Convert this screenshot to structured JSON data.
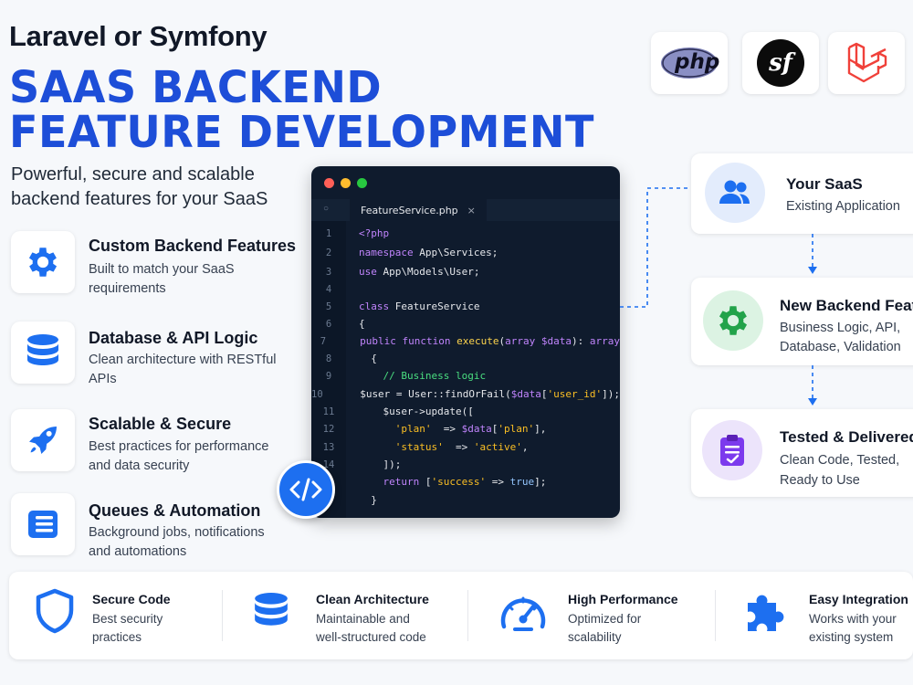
{
  "header": {
    "eyebrow": "Laravel or Symfony",
    "title_line1": "SAAS BACKEND",
    "title_line2": "FEATURE DEVELOPMENT",
    "subtitle": "Powerful, secure and scalable backend features for your SaaS"
  },
  "logos": [
    {
      "name": "php-logo",
      "text": "php"
    },
    {
      "name": "symfony-logo",
      "text": "sf"
    },
    {
      "name": "laravel-logo",
      "text": ""
    }
  ],
  "features": [
    {
      "title": "Custom Backend Features",
      "desc": "Built to match your SaaS requirements",
      "icon": "gear-icon"
    },
    {
      "title": "Database & API Logic",
      "desc": "Clean architecture with RESTful APIs",
      "icon": "database-icon"
    },
    {
      "title": "Scalable & Secure",
      "desc": "Best practices for performance and data security",
      "icon": "rocket-icon"
    },
    {
      "title": "Queues & Automation",
      "desc": "Background jobs, notifications and automations",
      "icon": "list-icon"
    }
  ],
  "editor": {
    "tab_label": "FeatureService.php",
    "line_numbers": [
      "1",
      "2",
      "3",
      "4",
      "5",
      "6",
      "7",
      "8",
      "9",
      "10",
      "11",
      "12",
      "13",
      "14"
    ]
  },
  "flow": [
    {
      "title": "Your SaaS",
      "desc1": "Existing Application",
      "desc2": "",
      "icon": "users-icon"
    },
    {
      "title": "New Backend Feat",
      "desc1": "Business Logic, API,",
      "desc2": "Database, Validation",
      "icon": "gear-icon"
    },
    {
      "title": "Tested & Delivered",
      "desc1": "Clean Code, Tested,",
      "desc2": "Ready to Use",
      "icon": "clipboard-check-icon"
    }
  ],
  "benefits": [
    {
      "title": "Secure Code",
      "desc1": "Best security",
      "desc2": "practices",
      "icon": "shield-icon"
    },
    {
      "title": "Clean Architecture",
      "desc1": "Maintainable and",
      "desc2": "well-structured code",
      "icon": "database-icon"
    },
    {
      "title": "High Performance",
      "desc1": "Optimized for",
      "desc2": "scalability",
      "icon": "speedometer-icon"
    },
    {
      "title": "Easy Integration",
      "desc1": "Works with your",
      "desc2": "existing system",
      "icon": "puzzle-icon"
    }
  ],
  "colors": {
    "brand_blue": "#1d4ed8",
    "editor_bg": "#0f1b2d",
    "green": "#22a34a",
    "purple": "#7c3aed"
  }
}
